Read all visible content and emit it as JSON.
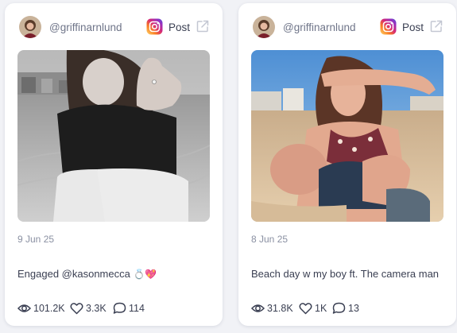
{
  "posts": [
    {
      "username": "@griffinarnlund",
      "platform": "instagram",
      "post_label": "Post",
      "date": "9 Jun 25",
      "caption_text": "Engaged @kasonmecca ",
      "caption_emojis": [
        "💍",
        "💖"
      ],
      "views": "101.2K",
      "likes": "3.3K",
      "comments": "114"
    },
    {
      "username": "@griffinarnlund",
      "platform": "instagram",
      "post_label": "Post",
      "date": "8 Jun 25",
      "caption_text": "Beach day w my boy ft. The camera man",
      "caption_emojis": [],
      "views": "31.8K",
      "likes": "1K",
      "comments": "13"
    }
  ],
  "icons": {
    "platform": "instagram-icon",
    "external": "external-link-icon",
    "views": "eye-icon",
    "likes": "heart-icon",
    "comments": "comment-icon"
  },
  "colors": {
    "background": "#f1f2f6",
    "card": "#ffffff",
    "text_primary": "#3a3f52",
    "text_secondary": "#8a90a2",
    "instagram_gradient": [
      "#feda75",
      "#fa7e1e",
      "#d62976",
      "#962fbf",
      "#4f5bd5"
    ]
  }
}
